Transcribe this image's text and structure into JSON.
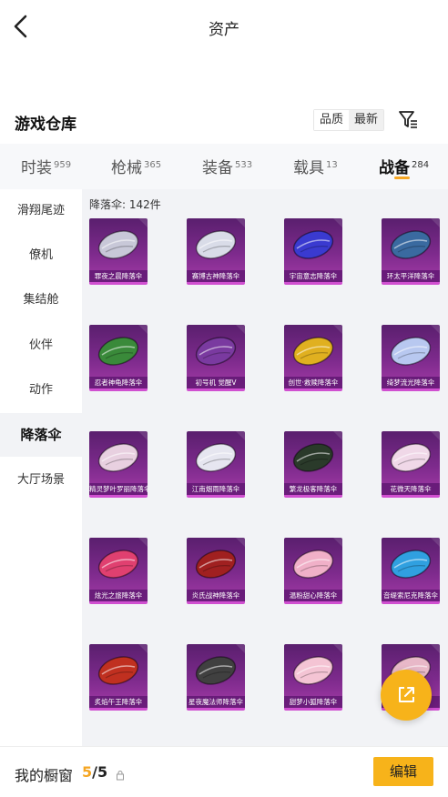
{
  "header": {
    "title": "资产"
  },
  "warehouse": {
    "title": "游戏仓库",
    "sort_quality": "品质",
    "sort_latest": "最新"
  },
  "tabs": [
    {
      "label": "时装",
      "count": "959"
    },
    {
      "label": "枪械",
      "count": "365"
    },
    {
      "label": "装备",
      "count": "533"
    },
    {
      "label": "载具",
      "count": "13"
    },
    {
      "label": "战备",
      "count": "284"
    }
  ],
  "sidebar": [
    "滑翔尾迹",
    "僚机",
    "集结舱",
    "伙伴",
    "动作",
    "降落伞",
    "大厅场景"
  ],
  "content": {
    "count_label": "降落伞: 142件"
  },
  "items": [
    {
      "label": "罪夜之晨降落伞",
      "art": "#c8c8d8"
    },
    {
      "label": "赛博古神降落伞",
      "art": "#d9dce8"
    },
    {
      "label": "宇宙意志降落伞",
      "art": "#3a3ad0"
    },
    {
      "label": "环太平洋降落伞",
      "art": "#3a6aa0"
    },
    {
      "label": "忍者神龟降落伞",
      "art": "#3a8a3a"
    },
    {
      "label": "初号机 觉醒V",
      "art": "#7a3aa0"
    },
    {
      "label": "创世·救赎降落伞",
      "art": "#e0b020"
    },
    {
      "label": "绮梦流光降落伞",
      "art": "#b8c8f0"
    },
    {
      "label": "精灵梦叶罗丽降落伞",
      "art": "#e8d0e0"
    },
    {
      "label": "江南烟雨降落伞",
      "art": "#e6e6f0"
    },
    {
      "label": "繁龙极客降落伞",
      "art": "#2a3a2a"
    },
    {
      "label": "花微天降落伞",
      "art": "#f0d8e8"
    },
    {
      "label": "炫光之旅降落伞",
      "art": "#e04070"
    },
    {
      "label": "炎氏战神降落伞",
      "art": "#a02020"
    },
    {
      "label": "温粉甜心降落伞",
      "art": "#f0b0c8"
    },
    {
      "label": "音缇索尼克降落伞",
      "art": "#30a0e0"
    },
    {
      "label": "炙焰午王降落伞",
      "art": "#c03020"
    },
    {
      "label": "星夜魔法师降落伞",
      "art": "#404040"
    },
    {
      "label": "甜梦小狐降落伞",
      "art": "#f4c4d4"
    },
    {
      "label": "",
      "art": "#e8b8c8"
    }
  ],
  "bottom": {
    "label": "我的橱窗",
    "used": "5",
    "total": "/5",
    "edit_label": "编辑"
  }
}
